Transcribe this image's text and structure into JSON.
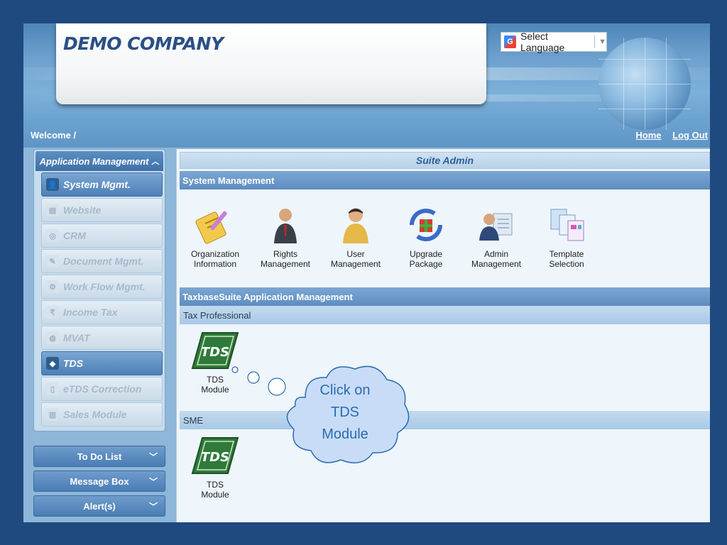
{
  "header": {
    "company_name": "DEMO COMPANY",
    "language_select": "Select Language",
    "welcome": "Welcome /",
    "links": [
      "Home",
      "Log Out"
    ]
  },
  "sidebar": {
    "panel_title": "Application Management",
    "items": [
      {
        "label": "System Mgmt.",
        "icon": "user-icon",
        "active": true
      },
      {
        "label": "Website",
        "icon": "website-icon",
        "active": false
      },
      {
        "label": "CRM",
        "icon": "crm-icon",
        "active": false
      },
      {
        "label": "Document Mgmt.",
        "icon": "document-icon",
        "active": false
      },
      {
        "label": "Work Flow Mgmt.",
        "icon": "workflow-icon",
        "active": false
      },
      {
        "label": "Income Tax",
        "icon": "income-tax-icon",
        "active": false
      },
      {
        "label": "MVAT",
        "icon": "mvat-icon",
        "active": false
      },
      {
        "label": "TDS",
        "icon": "tds-icon",
        "active": true
      },
      {
        "label": "eTDS Correction",
        "icon": "etds-icon",
        "active": false
      },
      {
        "label": "Sales Module",
        "icon": "sales-icon",
        "active": false
      }
    ],
    "buttons": [
      "To Do List",
      "Message Box",
      "Alert(s)"
    ]
  },
  "main": {
    "title": "Suite Admin",
    "system_management": {
      "heading": "System Management",
      "tiles": [
        {
          "label": "Organization\nInformation",
          "icon": "organization-icon"
        },
        {
          "label": "Rights\nManagement",
          "icon": "rights-icon"
        },
        {
          "label": "User\nManagement",
          "icon": "user-management-icon"
        },
        {
          "label": "Upgrade\nPackage",
          "icon": "upgrade-package-icon"
        },
        {
          "label": "Admin\nManagement",
          "icon": "admin-icon"
        },
        {
          "label": "Template\nSelection",
          "icon": "template-icon"
        }
      ]
    },
    "app_management": {
      "heading": "TaxbaseSuite Application Management",
      "tax_professional": {
        "label": "Tax Professional",
        "tile": "TDS\nModule"
      },
      "sme": {
        "label": "SME",
        "tile": "TDS\nModule"
      }
    }
  },
  "callout": {
    "text": "Click on\nTDS\nModule"
  },
  "colors": {
    "background": "#1f4a7f",
    "accent": "#5d8cc0",
    "callout": "#c8dcf7"
  }
}
